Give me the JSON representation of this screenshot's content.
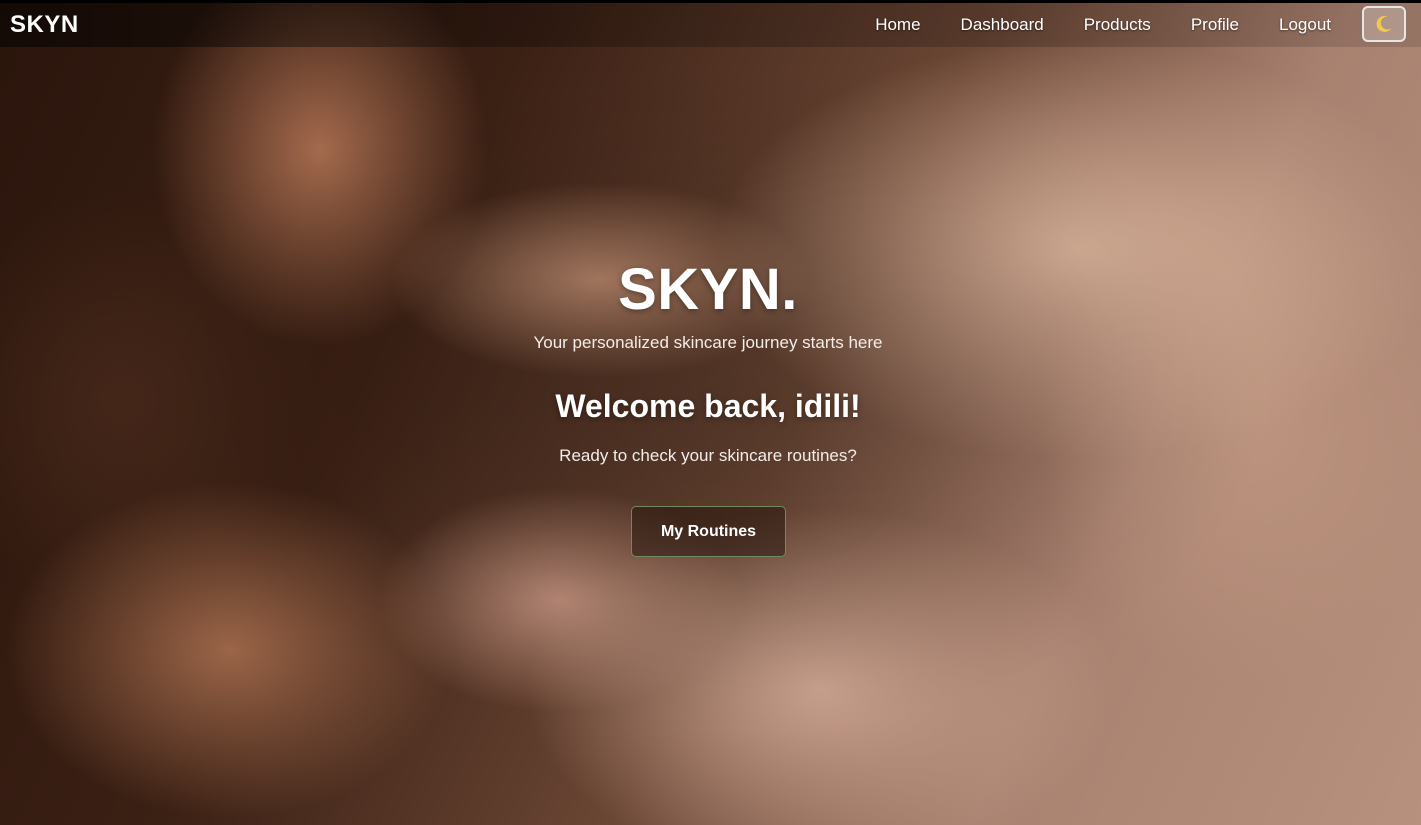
{
  "navbar": {
    "brand": "SKYN",
    "links": [
      {
        "label": "Home"
      },
      {
        "label": "Dashboard"
      },
      {
        "label": "Products"
      },
      {
        "label": "Profile"
      },
      {
        "label": "Logout"
      }
    ],
    "theme_toggle_icon": "moon-icon"
  },
  "hero": {
    "title": "SKYN.",
    "subtitle": "Your personalized skincare journey starts here",
    "welcome": "Welcome back, idili!",
    "prompt": "Ready to check your skincare routines?",
    "cta_label": "My Routines"
  },
  "colors": {
    "text": "#ffffff",
    "button_border": "#6f8a5e",
    "moon": "#f2c94c"
  }
}
